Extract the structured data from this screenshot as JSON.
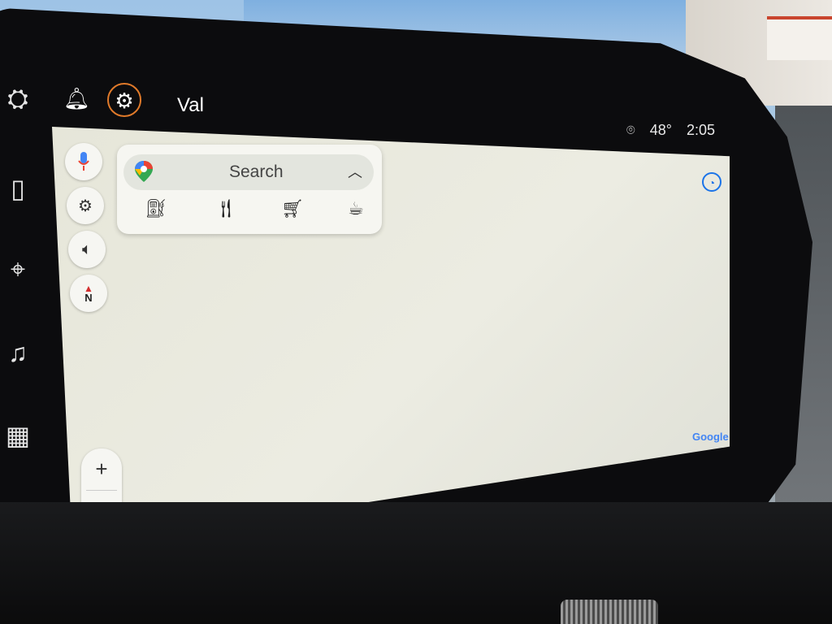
{
  "header": {
    "user_name": "Val",
    "temperature": "48°",
    "time": "2:05"
  },
  "search": {
    "label": "Search"
  },
  "map": {
    "watermark": "Google"
  },
  "compass": {
    "direction": "N"
  },
  "zoom": {
    "in_label": "+",
    "out_label": "−"
  },
  "categories": [
    {
      "icon": "gas-station-icon"
    },
    {
      "icon": "restaurant-icon"
    },
    {
      "icon": "shopping-cart-icon"
    },
    {
      "icon": "coffee-icon"
    }
  ],
  "colors": {
    "bezel": "#0c0c0e",
    "map_bg": "#e8e8dd",
    "gear_accent": "#e07a2a",
    "mic_blue": "#4285f4",
    "account_blue": "#1a73e8"
  }
}
